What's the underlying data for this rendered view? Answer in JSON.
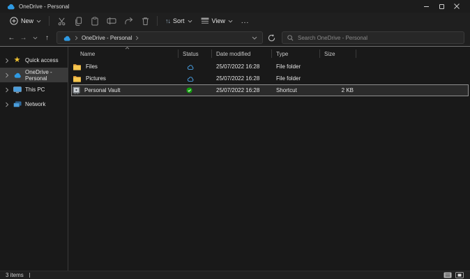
{
  "titlebar": {
    "title": "OneDrive - Personal"
  },
  "toolbar": {
    "new_label": "New",
    "sort_label": "Sort",
    "view_label": "View",
    "more_label": "...",
    "sort_glyph": "↑↓"
  },
  "addressbar": {
    "location": "OneDrive - Personal",
    "search_placeholder": "Search OneDrive - Personal"
  },
  "sidebar": {
    "items": [
      {
        "label": "Quick access"
      },
      {
        "label": "OneDrive - Personal"
      },
      {
        "label": "This PC"
      },
      {
        "label": "Network"
      }
    ]
  },
  "table": {
    "headers": [
      "Name",
      "Status",
      "Date modified",
      "Type",
      "Size"
    ],
    "rows": [
      {
        "name": "Files",
        "status_icon": "cloud-online-icon",
        "date": "25/07/2022 16:28",
        "type": "File folder",
        "size": ""
      },
      {
        "name": "Pictures",
        "status_icon": "cloud-online-icon",
        "date": "25/07/2022 16:28",
        "type": "File folder",
        "size": ""
      },
      {
        "name": "Personal Vault",
        "status_icon": "synced-check-icon",
        "date": "25/07/2022 16:28",
        "type": "Shortcut",
        "size": "2 KB"
      }
    ]
  },
  "statusbar": {
    "items_count": "3 items"
  },
  "colors": {
    "onedrive_blue": "#2f9ae3",
    "folder_yellow": "#f6c74f",
    "sync_green": "#13a10e",
    "selection_gray": "#3a3a3a"
  }
}
